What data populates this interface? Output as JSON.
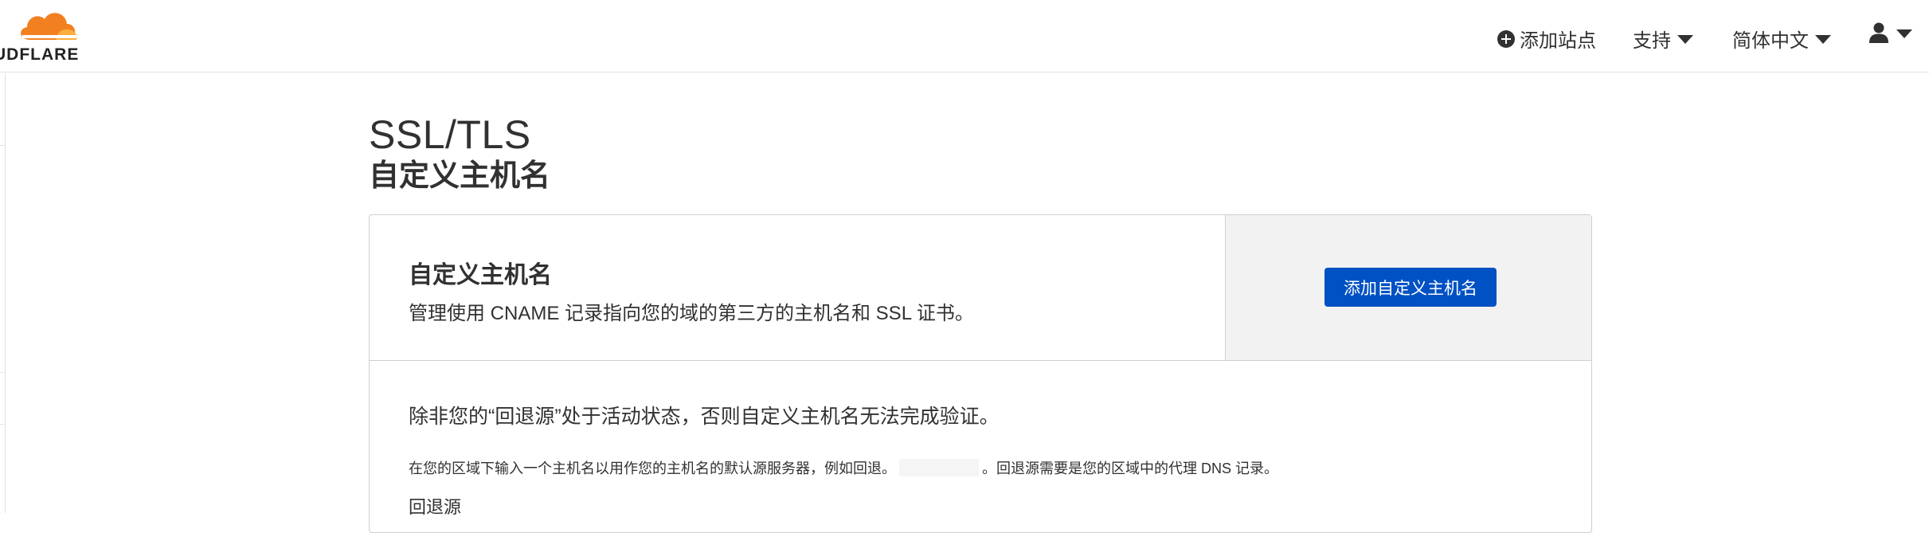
{
  "brand": {
    "logo_text": "UDFLARE",
    "logo_color_primary": "#f38020",
    "logo_color_secondary": "#faae40"
  },
  "nav": {
    "add_site": "添加站点",
    "support": "支持",
    "language": "简体中文",
    "user_icon": "user-icon"
  },
  "page": {
    "title": "SSL/TLS",
    "subtitle": "自定义主机名"
  },
  "card": {
    "title": "自定义主机名",
    "description": "管理使用 CNAME 记录指向您的域的第三方的主机名和 SSL 证书。",
    "button_label": "添加自定义主机名",
    "warning": "除非您的“回退源”处于活动状态，否则自定义主机名无法完成验证。",
    "hint_before": "在您的区域下输入一个主机名以用作您的主机名的默认源服务器，例如回退。",
    "hint_after": "。回退源需要是您的区域中的代理 DNS 记录。",
    "field_label": "回退源"
  },
  "colors": {
    "accent": "#0051c3",
    "text": "#313131",
    "panel_bg": "#f2f2f2",
    "border": "#cfcfcf"
  }
}
